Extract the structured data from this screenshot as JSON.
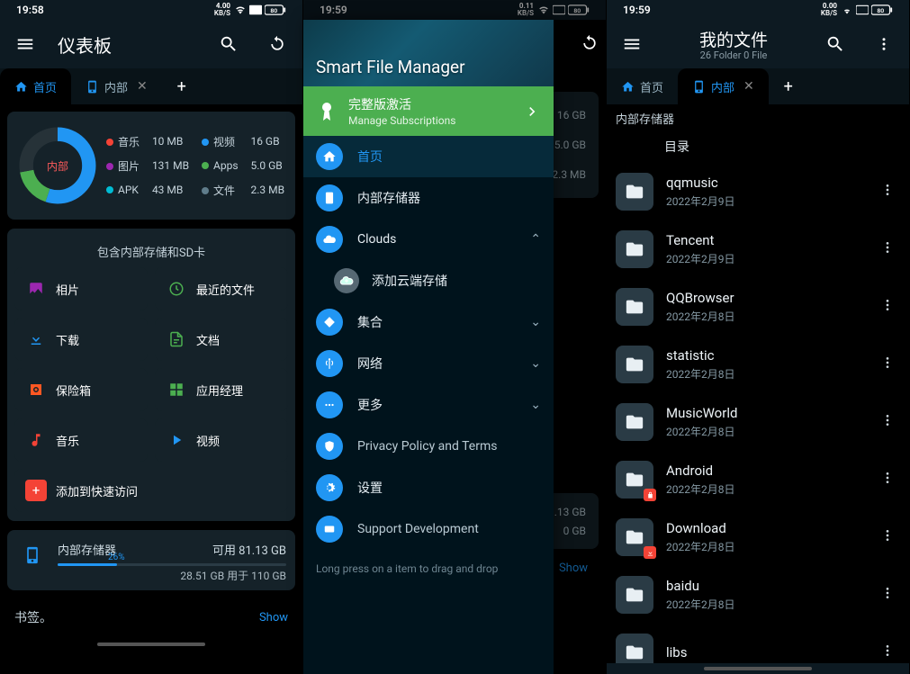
{
  "screen1": {
    "time": "19:58",
    "kbs": "4.00",
    "kbs_unit": "KB/S",
    "batt": "80",
    "title": "仪表板",
    "tab_home": "首页",
    "tab_internal": "内部",
    "donut_label": "内部",
    "legend": [
      {
        "dot": "#f44336",
        "name": "音乐",
        "val": "10 MB"
      },
      {
        "dot": "#2196f3",
        "name": "视频",
        "val": "16 GB"
      },
      {
        "dot": "#9c27b0",
        "name": "图片",
        "val": "131 MB"
      },
      {
        "dot": "#4caf50",
        "name": "Apps",
        "val": "5.0 GB"
      },
      {
        "dot": "#00bcd4",
        "name": "APK",
        "val": "43 MB"
      },
      {
        "dot": "#607d8b",
        "name": "文件",
        "val": "2.3 MB"
      }
    ],
    "section_title": "包含内部存储和SD卡",
    "tiles": [
      {
        "icon": "photo",
        "color": "#9c27b0",
        "label": "相片"
      },
      {
        "icon": "recent",
        "color": "#4caf50",
        "label": "最近的文件"
      },
      {
        "icon": "download",
        "color": "#2196f3",
        "label": "下载"
      },
      {
        "icon": "doc",
        "color": "#4caf50",
        "label": "文档"
      },
      {
        "icon": "vault",
        "color": "#ff5722",
        "label": "保险箱"
      },
      {
        "icon": "apps",
        "color": "#4caf50",
        "label": "应用经理"
      },
      {
        "icon": "music",
        "color": "#f44336",
        "label": "音乐"
      },
      {
        "icon": "video",
        "color": "#2196f3",
        "label": "视频"
      }
    ],
    "add_quick": "添加到快速访问",
    "storage_name": "内部存储器",
    "storage_avail": "可用 81.13 GB",
    "storage_pct": "26%",
    "storage_pct_val": 26,
    "storage_used": "28.51 GB 用于 110 GB",
    "bookmark": "书签。",
    "show": "Show"
  },
  "screen2": {
    "time": "19:59",
    "kbs": "0.11",
    "kbs_unit": "KB/S",
    "batt": "80",
    "drawer_title": "Smart File Manager",
    "banner_title": "完整版激活",
    "banner_sub": "Manage Subscriptions",
    "items": {
      "home": "首页",
      "internal": "内部存储器",
      "clouds": "Clouds",
      "add_cloud": "添加云端存储",
      "collections": "集合",
      "network": "网络",
      "more": "更多",
      "privacy": "Privacy Policy and Terms",
      "settings": "设置",
      "support": "Support Development"
    },
    "hint": "Long press on a item to drag and drop",
    "under_vals": [
      "16 GB",
      "5.0 GB",
      "2.3 MB"
    ],
    "under_v1": ".13 GB",
    "under_v2": "0 GB",
    "show": "Show"
  },
  "screen3": {
    "time": "19:59",
    "kbs": "0.00",
    "kbs_unit": "KB/S",
    "batt": "80",
    "title": "我的文件",
    "subtitle": "26 Folder 0 File",
    "tab_home": "首页",
    "tab_internal": "内部",
    "section": "内部存储器",
    "dir": "目录",
    "files": [
      {
        "name": "qqmusic",
        "date": "2022年2月9日",
        "badge": ""
      },
      {
        "name": "Tencent",
        "date": "2022年2月9日",
        "badge": ""
      },
      {
        "name": "QQBrowser",
        "date": "2022年2月8日",
        "badge": ""
      },
      {
        "name": "statistic",
        "date": "2022年2月8日",
        "badge": ""
      },
      {
        "name": "MusicWorld",
        "date": "2022年2月8日",
        "badge": ""
      },
      {
        "name": "Android",
        "date": "2022年2月8日",
        "badge": "lock"
      },
      {
        "name": "Download",
        "date": "2022年2月8日",
        "badge": "down"
      },
      {
        "name": "baidu",
        "date": "2022年2月8日",
        "badge": ""
      },
      {
        "name": "libs",
        "date": "",
        "badge": ""
      }
    ]
  }
}
